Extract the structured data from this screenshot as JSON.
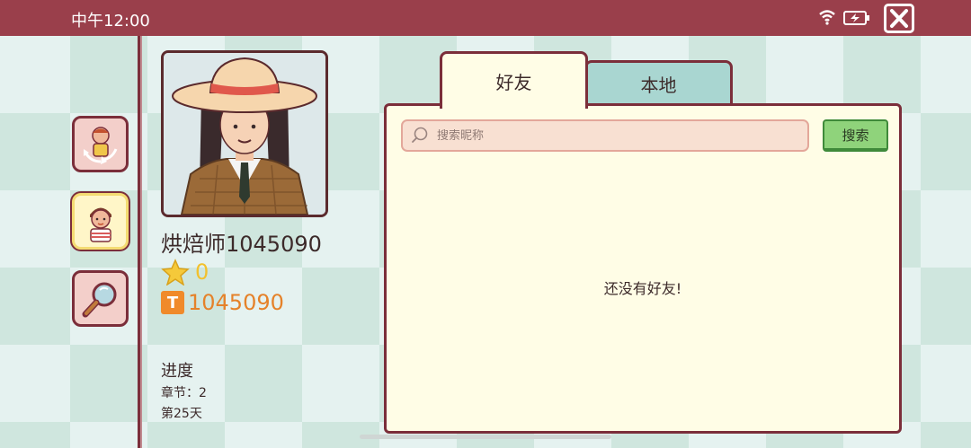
{
  "status_bar": {
    "time": "中午12:00",
    "icons": [
      "wifi-icon",
      "battery-charging-icon"
    ],
    "close_icon": "close-icon"
  },
  "side_menu": [
    {
      "name": "character-swap",
      "icon": "character-swap-icon",
      "active": false
    },
    {
      "name": "profile",
      "icon": "profile-icon",
      "active": true
    },
    {
      "name": "search",
      "icon": "magnifier-icon",
      "active": false
    }
  ],
  "profile": {
    "name": "烘焙师1045090",
    "stars": "0",
    "id": "1045090",
    "id_badge": "T",
    "progress_title": "进度",
    "chapter": "章节：2",
    "day": "第25天"
  },
  "tabs": [
    {
      "label": "好友",
      "selected": true
    },
    {
      "label": "本地",
      "selected": false
    }
  ],
  "friends_panel": {
    "search_placeholder": "搜索昵称",
    "search_button": "搜索",
    "empty_message": "还没有好友!"
  },
  "colors": {
    "status_bar": "#9a3f4b",
    "border": "#7b2e3a",
    "panel_bg": "#fffde6",
    "tab_inactive": "#a9d6d1",
    "search_button": "#8fd37b",
    "star": "#f2c12e",
    "id_orange": "#e5822a"
  }
}
